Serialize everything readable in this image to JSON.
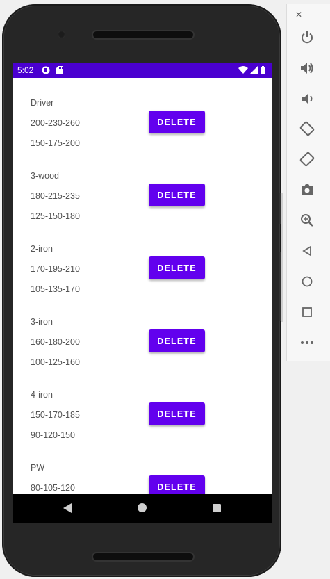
{
  "status_bar": {
    "time": "5:02",
    "color": "#4a00d0",
    "icons": [
      "notification-app-icon",
      "sd-card-icon",
      "wifi-icon",
      "cell-signal-icon",
      "battery-icon"
    ]
  },
  "clubs": [
    {
      "name": "Driver",
      "range1": "200-230-260",
      "range2": "150-175-200",
      "delete_label": "DELETE"
    },
    {
      "name": "3-wood",
      "range1": "180-215-235",
      "range2": "125-150-180",
      "delete_label": "DELETE"
    },
    {
      "name": "2-iron",
      "range1": "170-195-210",
      "range2": "105-135-170",
      "delete_label": "DELETE"
    },
    {
      "name": "3-iron",
      "range1": "160-180-200",
      "range2": "100-125-160",
      "delete_label": "DELETE"
    },
    {
      "name": "4-iron",
      "range1": "150-170-185",
      "range2": "90-120-150",
      "delete_label": "DELETE"
    },
    {
      "name": "PW",
      "range1": "80-105-120",
      "range2": "",
      "delete_label": "DELETE"
    }
  ],
  "button_color": "#6200ee",
  "nav_bar": {
    "icons": [
      "back-icon",
      "home-icon",
      "recents-icon"
    ]
  },
  "emulator_panel": {
    "tools": [
      "power-icon",
      "volume-up-icon",
      "volume-down-icon",
      "rotate-left-icon",
      "rotate-right-icon",
      "camera-icon",
      "zoom-icon",
      "back-icon",
      "home-icon",
      "overview-icon",
      "more-icon"
    ]
  }
}
